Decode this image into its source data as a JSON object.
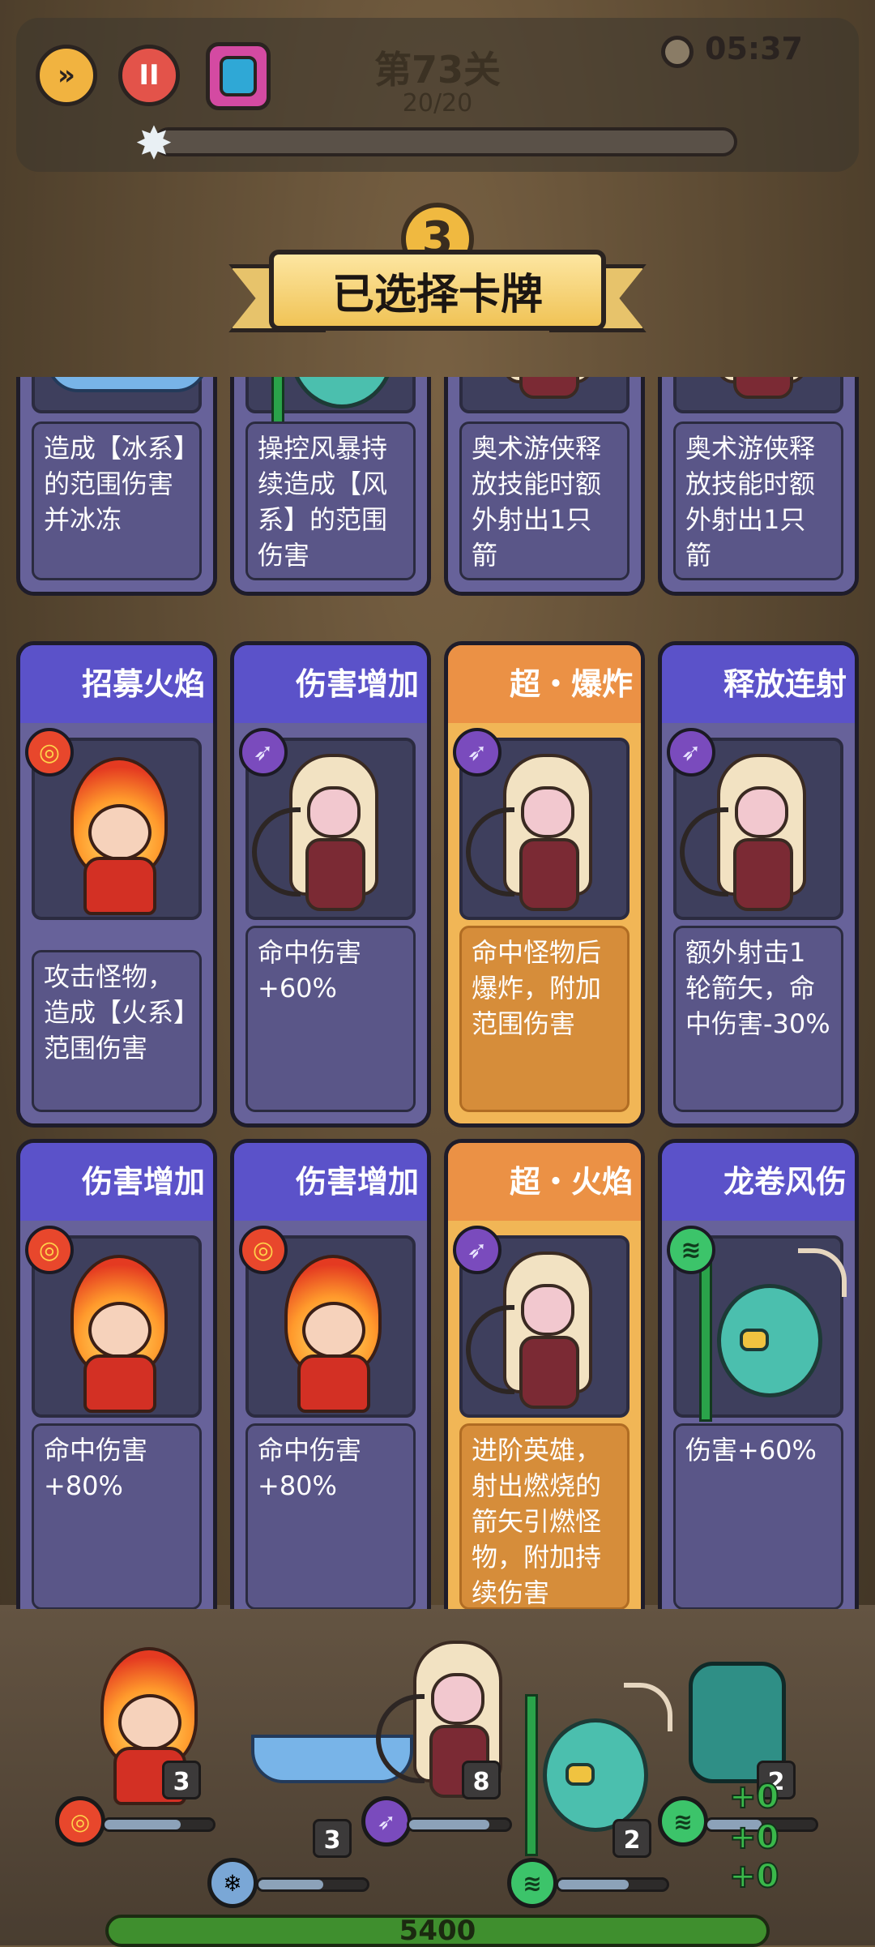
{
  "hud": {
    "level_title": "第73关",
    "wave": "20/20",
    "timer": "05:37",
    "progress": 0.0,
    "countdown": "3"
  },
  "banner": {
    "title": "已选择卡牌"
  },
  "cards_top": [
    {
      "desc": "造成【冰系】的范围伤害并冰冻",
      "variant": "blue"
    },
    {
      "desc": "操控风暴持续造成【风系】的范围伤害",
      "variant": "blue"
    },
    {
      "desc": "奥术游侠释放技能时额外射出1只箭",
      "variant": "blue"
    },
    {
      "desc": "奥术游侠释放技能时额外射出1只箭",
      "variant": "blue"
    }
  ],
  "cards_mid": [
    {
      "title": "招募火焰",
      "desc": "攻击怪物，造成【火系】范围伤害",
      "type": "fire",
      "variant": "blue",
      "char": "fire"
    },
    {
      "title": "伤害增加",
      "desc": "命中伤害+60%",
      "type": "arrow",
      "variant": "blue",
      "char": "archer"
    },
    {
      "title": "超・爆炸",
      "desc": "命中怪物后爆炸，附加范围伤害",
      "type": "arrow",
      "variant": "orange",
      "char": "archer"
    },
    {
      "title": "释放连射",
      "desc": "额外射击1轮箭矢，命中伤害-30%",
      "type": "arrow",
      "variant": "blue",
      "char": "archer"
    }
  ],
  "cards_bot": [
    {
      "title": "伤害增加",
      "desc": "命中伤害+80%",
      "type": "fire",
      "variant": "blue",
      "char": "fire"
    },
    {
      "title": "伤害增加",
      "desc": "命中伤害+80%",
      "type": "fire",
      "variant": "blue",
      "char": "fire"
    },
    {
      "title": "超・火焰",
      "desc": "进阶英雄，射出燃烧的箭矢引燃怪物，附加持续伤害",
      "type": "arrow",
      "variant": "orange",
      "char": "archer"
    },
    {
      "title": "龙卷风伤",
      "desc": "伤害+60%",
      "type": "wind",
      "variant": "blue",
      "char": "bird"
    }
  ],
  "battle": {
    "hero_levels": [
      "3",
      "3",
      "8",
      "2",
      "2"
    ],
    "bonus": [
      "+0",
      "+0",
      "+0"
    ],
    "coins": "5400"
  },
  "colors": {
    "card_blue": "#5b52c9",
    "card_orange": "#eb9145"
  }
}
